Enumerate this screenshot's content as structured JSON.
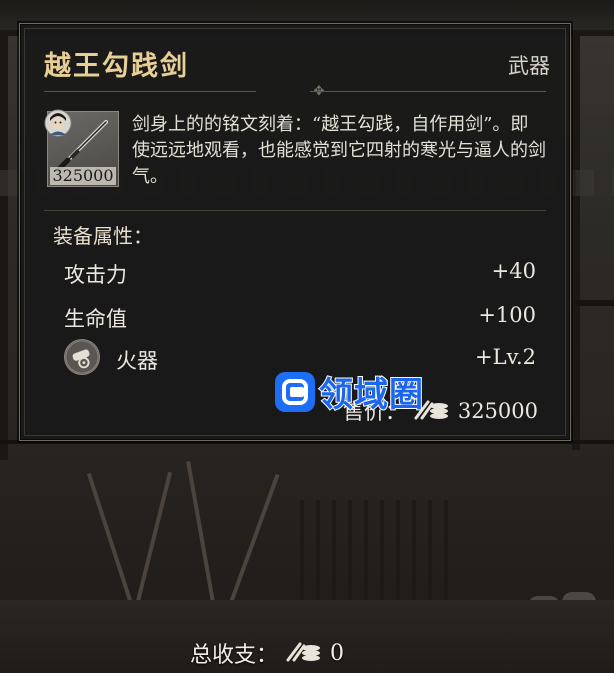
{
  "item": {
    "name": "越王勾践剑",
    "type": "武器",
    "icon": "sword-icon",
    "icon_price": "325000",
    "description": "剑身上的的铭文刻着：“越王勾践，自作用剑”。即使远远地观看，也能感觉到它四射的寒光与逼人的剑气。"
  },
  "attributes": {
    "section_label": "装备属性：",
    "stats": [
      {
        "name": "攻击力",
        "value": "+40"
      },
      {
        "name": "生命值",
        "value": "+100"
      },
      {
        "name": "火器",
        "value": "+Lv.2",
        "icon": "cannon-icon"
      }
    ]
  },
  "sell": {
    "label": "售价：",
    "value": "325000",
    "icon": "coin-stack-icon"
  },
  "watermark": {
    "text": "领域圈",
    "color": "#1a66ee"
  },
  "footer": {
    "label": "总收支：",
    "value": "0",
    "icon": "coin-stack-icon"
  },
  "colors": {
    "title_gold": "#e7cf97",
    "panel_bg": "#181818",
    "text": "#ece8df"
  }
}
